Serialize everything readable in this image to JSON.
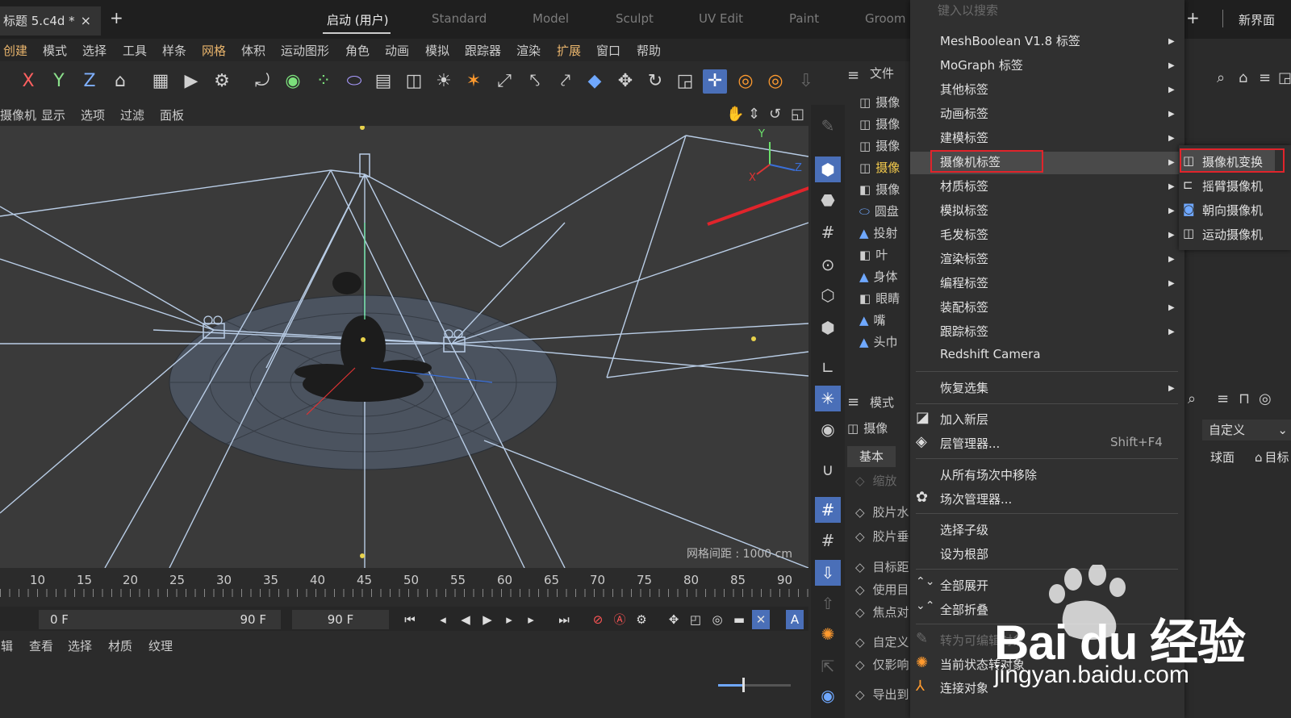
{
  "tabbar": {
    "doc_title": "标题 5.c4d *",
    "close": "×",
    "new_tab": "+",
    "layouts": [
      "启动 (用户)",
      "Standard",
      "Model",
      "Sculpt",
      "UV Edit",
      "Paint",
      "Groom"
    ],
    "right_plus": "+",
    "new_layout": "新界面"
  },
  "menubar": [
    "创建",
    "模式",
    "选择",
    "工具",
    "样条",
    "网格",
    "体积",
    "运动图形",
    "角色",
    "动画",
    "模拟",
    "跟踪器",
    "渲染",
    "扩展",
    "窗口",
    "帮助"
  ],
  "toolbar": [
    "X",
    "Y",
    "Z"
  ],
  "viewport": {
    "menu": [
      "摄像机",
      "显示",
      "选项",
      "过滤",
      "面板"
    ],
    "grid_distance": "网格间距 : 1000 cm",
    "axis_x": "X",
    "axis_y": "Y",
    "axis_z": "Z"
  },
  "timeline": {
    "ticks": [
      "10",
      "15",
      "20",
      "25",
      "30",
      "35",
      "40",
      "45",
      "50",
      "55",
      "60",
      "65",
      "70",
      "75",
      "80",
      "85",
      "90"
    ],
    "start_frame": "0 F",
    "end_frame": "90 F",
    "current_frame": "90 F"
  },
  "material_menu": [
    "编辑",
    "查看",
    "选择",
    "材质",
    "纹理"
  ],
  "object_manager": {
    "header": "文件",
    "rows": [
      "摄像",
      "摄像",
      "摄像",
      "摄像",
      "摄像",
      "圆盘",
      "投射",
      "叶",
      "身体",
      "眼睛",
      "嘴",
      "头巾"
    ]
  },
  "attribute_manager": {
    "header": "模式",
    "object": "摄像",
    "tab_basic": "基本",
    "rows": [
      "缩放",
      "胶片水",
      "胶片垂",
      "目标距",
      "使用目",
      "焦点对",
      "自定义",
      "仅影响",
      "导出到"
    ]
  },
  "right_panel": {
    "preset": "自定义",
    "tab_sphere": "球面",
    "tab_target": "目标"
  },
  "context_menu": {
    "search_placeholder": "键入以搜索",
    "items": [
      {
        "label": "MeshBoolean V1.8 标签",
        "arrow": "▶"
      },
      {
        "label": "MoGraph 标签",
        "arrow": "▶"
      },
      {
        "label": "其他标签",
        "arrow": "▶"
      },
      {
        "label": "动画标签",
        "arrow": "▶"
      },
      {
        "label": "建模标签",
        "arrow": "▶"
      },
      {
        "label": "摄像机标签",
        "arrow": "▶"
      },
      {
        "label": "材质标签",
        "arrow": "▶"
      },
      {
        "label": "模拟标签",
        "arrow": "▶"
      },
      {
        "label": "毛发标签",
        "arrow": "▶"
      },
      {
        "label": "渲染标签",
        "arrow": "▶"
      },
      {
        "label": "编程标签",
        "arrow": "▶"
      },
      {
        "label": "装配标签",
        "arrow": "▶"
      },
      {
        "label": "跟踪标签",
        "arrow": "▶"
      },
      {
        "label": "Redshift Camera",
        "arrow": ""
      },
      {
        "label": "恢复选集",
        "arrow": "▶"
      },
      {
        "label": "加入新层",
        "arrow": ""
      },
      {
        "label": "层管理器...",
        "arrow": ""
      },
      {
        "label": "从所有场次中移除",
        "arrow": ""
      },
      {
        "label": "场次管理器...",
        "arrow": ""
      },
      {
        "label": "选择子级",
        "arrow": ""
      },
      {
        "label": "设为根部",
        "arrow": ""
      },
      {
        "label": "全部展开",
        "arrow": ""
      },
      {
        "label": "全部折叠",
        "arrow": ""
      },
      {
        "label": "转为可编辑对象",
        "arrow": ""
      },
      {
        "label": "当前状态转对象",
        "arrow": ""
      },
      {
        "label": "连接对象",
        "arrow": ""
      }
    ],
    "layer_manager_shortcut": "Shift+F4"
  },
  "submenu": [
    "摄像机变换",
    "摇臂摄像机",
    "朝向摄像机",
    "运动摄像机"
  ],
  "watermark": {
    "brand": "Bai du 经验",
    "url": "jingyan.baidu.com"
  },
  "colors": {
    "highlight_box": "#e0242b",
    "accent_blue": "#4a6fb8",
    "menu_highlight": "#e8b46c"
  }
}
